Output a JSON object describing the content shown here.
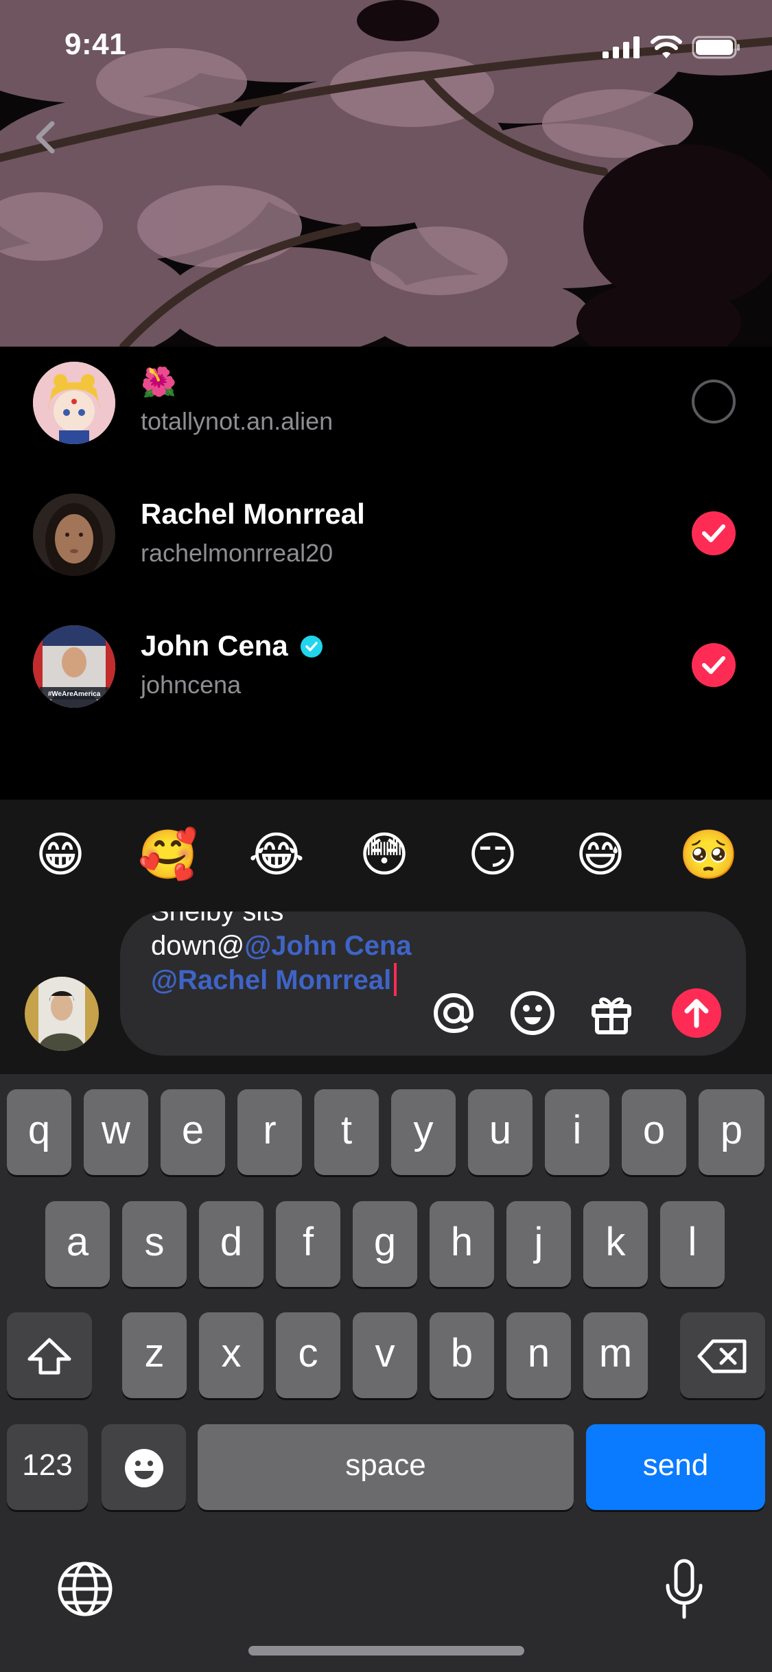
{
  "status_bar": {
    "time": "9:41"
  },
  "mention_list": [
    {
      "name": "🌺",
      "handle": "totallynot.an.alien",
      "selected": false,
      "verified": false
    },
    {
      "name": "Rachel Monrreal",
      "handle": "rachelmonrreal20",
      "selected": true,
      "verified": false
    },
    {
      "name": "John Cena",
      "handle": "johncena",
      "selected": true,
      "verified": true
    }
  ],
  "john_avatar_caption": "#WeAreAmerica",
  "emoji_bar": [
    "😁",
    "🥰",
    "😂",
    "😳",
    "😏",
    "😅",
    "🥺"
  ],
  "comment": {
    "text_before": "Shelby sits down@",
    "mention_1": "@John Cena",
    "mention_2": "@Rachel Monrreal"
  },
  "keyboard": {
    "row1": [
      "q",
      "w",
      "e",
      "r",
      "t",
      "y",
      "u",
      "i",
      "o",
      "p"
    ],
    "row2": [
      "a",
      "s",
      "d",
      "f",
      "g",
      "h",
      "j",
      "k",
      "l"
    ],
    "row3": [
      "z",
      "x",
      "c",
      "v",
      "b",
      "n",
      "m"
    ],
    "numbers_label": "123",
    "space_label": "space",
    "send_label": "send"
  },
  "colors": {
    "accent": "#fe2c55",
    "mention": "#3f64c7",
    "send_key": "#0a7aff",
    "verified": "#20d5ec"
  }
}
